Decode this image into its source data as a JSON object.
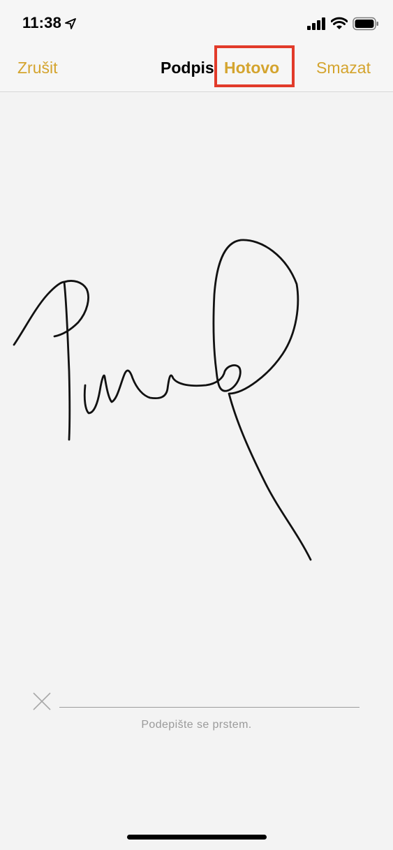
{
  "status_bar": {
    "time": "11:38",
    "icons": [
      "location-arrow-icon",
      "cellular-signal-icon",
      "wifi-icon",
      "battery-icon"
    ]
  },
  "nav": {
    "cancel_label": "Zrušit",
    "title": "Podpis",
    "done_label": "Hotovo",
    "clear_label": "Smazat",
    "accent_color": "#d4a42e",
    "highlight_color": "#e23b2a"
  },
  "signature_area": {
    "clear_mark_icon": "x-icon",
    "hint": "Podepište se prstem."
  }
}
